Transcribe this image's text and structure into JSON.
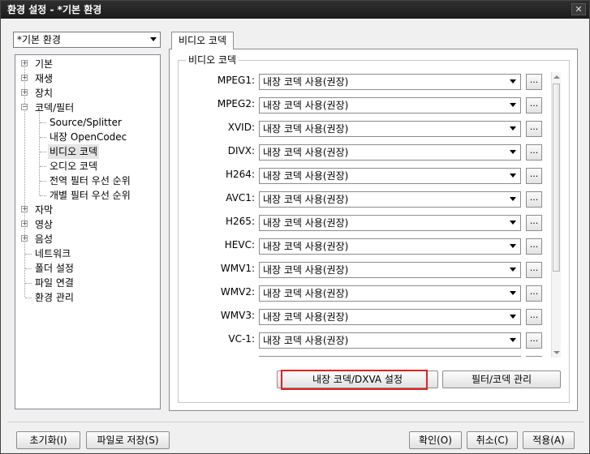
{
  "window": {
    "title": "환경 설정 - *기본 환경",
    "close_label": "✕"
  },
  "profile": {
    "selected": "*기본 환경"
  },
  "tree": {
    "items": [
      {
        "label": "기본",
        "expander": "+"
      },
      {
        "label": "재생",
        "expander": "+"
      },
      {
        "label": "장치",
        "expander": "+"
      },
      {
        "label": "코덱/필터",
        "expander": "−"
      },
      {
        "label": "Source/Splitter"
      },
      {
        "label": "내장 OpenCodec"
      },
      {
        "label": "비디오 코덱"
      },
      {
        "label": "오디오 코덱"
      },
      {
        "label": "전역 필터 우선 순위"
      },
      {
        "label": "개별 필터 우선 순위"
      },
      {
        "label": "자막",
        "expander": "+"
      },
      {
        "label": "영상",
        "expander": "+"
      },
      {
        "label": "음성",
        "expander": "+"
      },
      {
        "label": "네트워크"
      },
      {
        "label": "폴더 설정"
      },
      {
        "label": "파일 연결"
      },
      {
        "label": "환경 관리"
      }
    ]
  },
  "tab": {
    "label": "비디오 코덱"
  },
  "group": {
    "legend": "비디오 코덱"
  },
  "codecs": [
    {
      "name": "MPEG1:",
      "value": "내장 코덱 사용(권장)",
      "more": "..."
    },
    {
      "name": "MPEG2:",
      "value": "내장 코덱 사용(권장)",
      "more": "..."
    },
    {
      "name": "XVID:",
      "value": "내장 코덱 사용(권장)",
      "more": "..."
    },
    {
      "name": "DIVX:",
      "value": "내장 코덱 사용(권장)",
      "more": "..."
    },
    {
      "name": "H264:",
      "value": "내장 코덱 사용(권장)",
      "more": "..."
    },
    {
      "name": "AVC1:",
      "value": "내장 코덱 사용(권장)",
      "more": "..."
    },
    {
      "name": "H265:",
      "value": "내장 코덱 사용(권장)",
      "more": "..."
    },
    {
      "name": "HEVC:",
      "value": "내장 코덱 사용(권장)",
      "more": "..."
    },
    {
      "name": "WMV1:",
      "value": "내장 코덱 사용(권장)",
      "more": "..."
    },
    {
      "name": "WMV2:",
      "value": "내장 코덱 사용(권장)",
      "more": "..."
    },
    {
      "name": "WMV3:",
      "value": "내장 코덱 사용(권장)",
      "more": "..."
    },
    {
      "name": "VC-1:",
      "value": "내장 코덱 사용(권장)",
      "more": "..."
    }
  ],
  "actions": {
    "dxva": "내장 코덱/DXVA 설정",
    "manage": "필터/코덱 관리"
  },
  "footer": {
    "reset": "초기화(I)",
    "save_file": "파일로 저장(S)",
    "ok": "확인(O)",
    "cancel": "취소(C)",
    "apply": "적용(A)"
  },
  "colors": {
    "highlight": "#e02020",
    "title_bg": "#1c1c1c"
  }
}
